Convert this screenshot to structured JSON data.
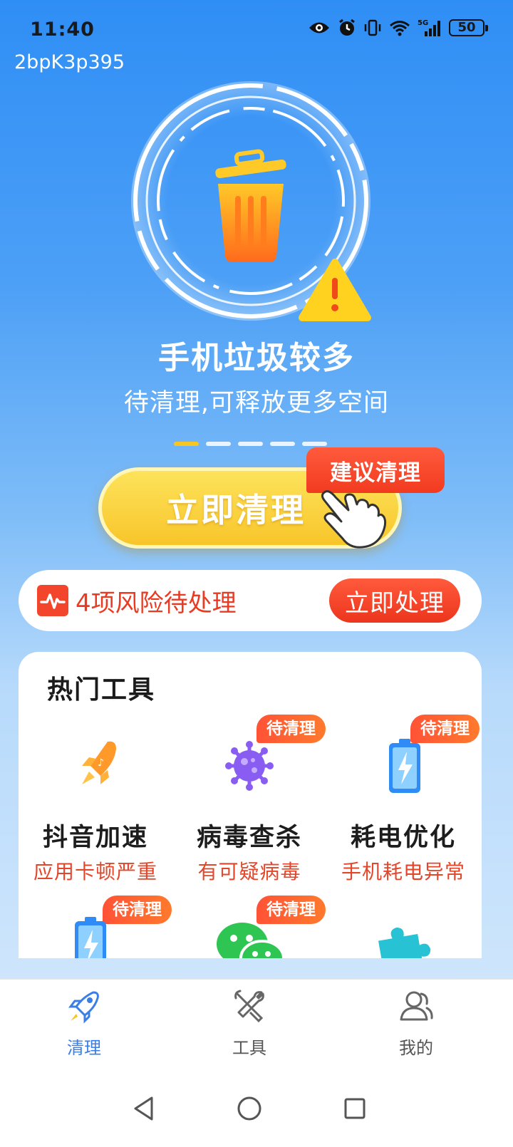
{
  "status_bar": {
    "time": "11:40",
    "battery": "50",
    "network": "5G"
  },
  "device_code": "2bpK3p395",
  "hero": {
    "headline": "手机垃圾较多",
    "subline": "待清理,可释放更多空间",
    "carousel_total": 5,
    "carousel_active": 0
  },
  "clean_button": {
    "label": "立即清理",
    "tag": "建议清理"
  },
  "risk": {
    "text": "4项风险待处理",
    "button": "立即处理"
  },
  "tools": {
    "title": "热门工具",
    "badge": "待清理",
    "items": [
      {
        "name": "抖音加速",
        "desc": "应用卡顿严重",
        "icon": "rocket-icon",
        "badge": false
      },
      {
        "name": "病毒查杀",
        "desc": "有可疑病毒",
        "icon": "virus-icon",
        "badge": true
      },
      {
        "name": "耗电优化",
        "desc": "手机耗电异常",
        "icon": "battery-icon",
        "badge": true
      },
      {
        "name": "",
        "desc": "",
        "icon": "battery-icon",
        "badge": true
      },
      {
        "name": "",
        "desc": "",
        "icon": "wechat-icon",
        "badge": true
      },
      {
        "name": "",
        "desc": "",
        "icon": "puzzle-icon",
        "badge": false
      }
    ]
  },
  "bottom_nav": {
    "items": [
      {
        "label": "清理",
        "icon": "rocket-icon",
        "active": true
      },
      {
        "label": "工具",
        "icon": "tools-icon",
        "active": false
      },
      {
        "label": "我的",
        "icon": "user-icon",
        "active": false
      }
    ]
  },
  "colors": {
    "accent": "#3a7ee6",
    "warning": "#f2452b",
    "button": "#f8c52a"
  }
}
